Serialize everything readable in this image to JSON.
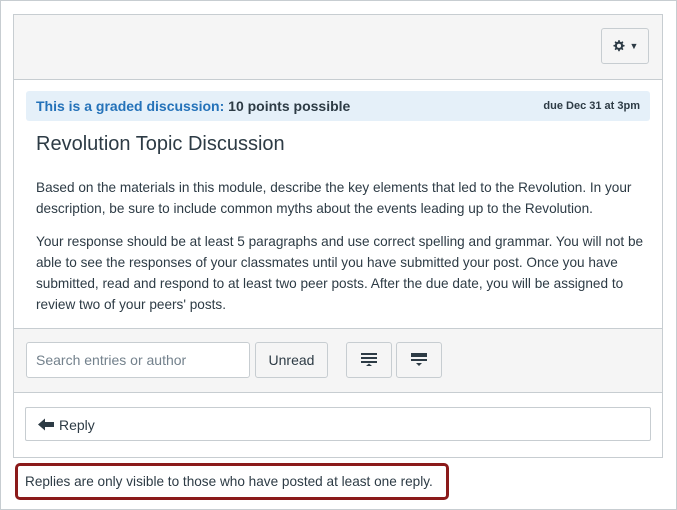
{
  "header": {
    "settings_icon": "gear-icon",
    "settings_caret": "▼"
  },
  "graded": {
    "lead": "This is a graded discussion:",
    "points": "10 points possible",
    "due": "due Dec 31 at 3pm"
  },
  "topic": {
    "title": "Revolution Topic Discussion",
    "paragraphs": [
      "Based on the materials in this module, describe the key elements that led to the Revolution. In your description, be sure to include common myths about the events leading up to the Revolution.",
      "Your response should be at least 5 paragraphs and use correct spelling and grammar. You will not be able to see the responses of your classmates until you have submitted your post. Once you have submitted, read and respond to at least two peer posts. After the due date, you will be assigned to review two of your peers' posts."
    ]
  },
  "toolbar": {
    "search_placeholder": "Search entries or author",
    "unread_label": "Unread",
    "expand_icon": "expand-all-icon",
    "collapse_icon": "collapse-all-icon"
  },
  "reply": {
    "label": "Reply",
    "icon": "reply-arrow-icon"
  },
  "notice": {
    "text": "Replies are only visible to those who have posted at least one reply."
  },
  "colors": {
    "accent_blue": "#2472b9",
    "graded_bg": "#e5f0f9",
    "highlight_border": "#8b1a1a",
    "text": "#2d3b45",
    "border": "#c7cdd1"
  }
}
